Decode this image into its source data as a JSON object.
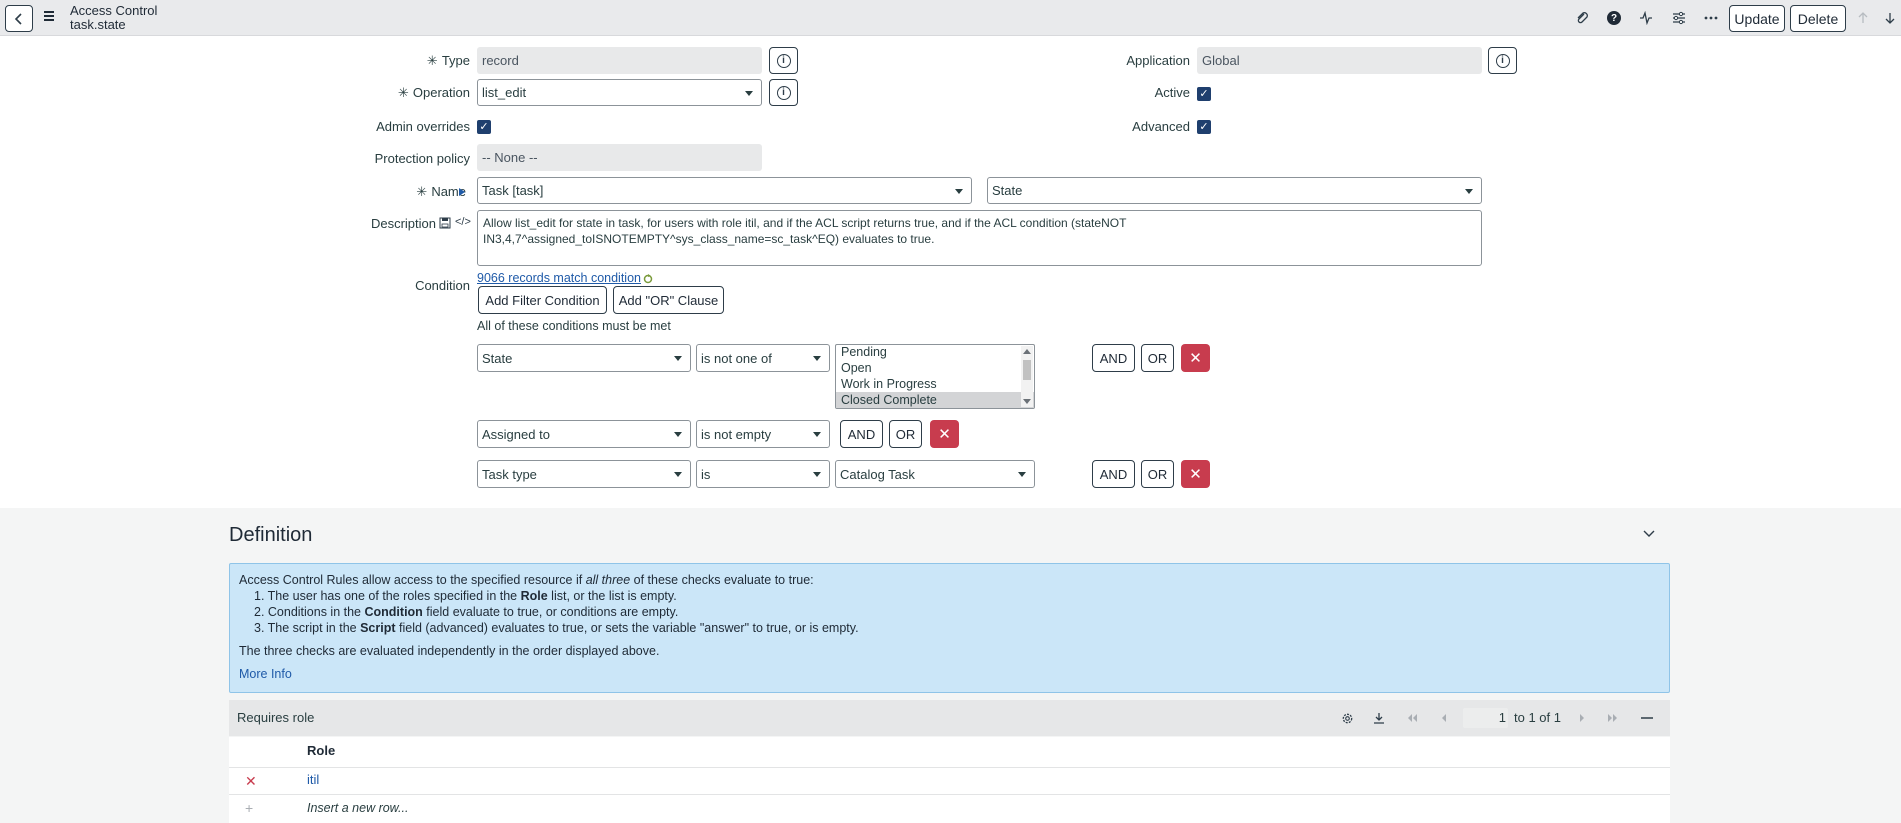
{
  "header": {
    "title_line1": "Access Control",
    "title_line2": "task.state",
    "update_label": "Update",
    "delete_label": "Delete"
  },
  "form": {
    "type": {
      "label": "Type",
      "value": "record"
    },
    "application": {
      "label": "Application",
      "value": "Global"
    },
    "operation": {
      "label": "Operation",
      "value": "list_edit"
    },
    "active": {
      "label": "Active",
      "checked": true
    },
    "admin_overrides": {
      "label": "Admin overrides",
      "checked": true
    },
    "advanced": {
      "label": "Advanced",
      "checked": true
    },
    "protection_policy": {
      "label": "Protection policy",
      "value": "-- None --"
    },
    "name": {
      "label": "Name",
      "table": "Task [task]",
      "field": "State"
    },
    "description": {
      "label": "Description",
      "line1": "Allow list_edit for state in task, for users with role itil, and if the ACL script returns true, and if the ACL condition (stateNOT",
      "line2": "IN3,4,7^assigned_toISNOTEMPTY^sys_class_name=sc_task^EQ) evaluates to true."
    },
    "condition": {
      "label": "Condition",
      "match_link": "9066 records match condition",
      "add_filter_label": "Add Filter Condition",
      "add_or_label": "Add \"OR\" Clause",
      "all_met_text": "All of these conditions must be met",
      "and_label": "AND",
      "or_label": "OR",
      "rows": [
        {
          "field": "State",
          "operator": "is not one of",
          "options": [
            "Pending",
            "Open",
            "Work in Progress",
            "Closed Complete"
          ],
          "selected": "Closed Complete"
        },
        {
          "field": "Assigned to",
          "operator": "is not empty"
        },
        {
          "field": "Task type",
          "operator": "is",
          "value": "Catalog Task"
        }
      ]
    }
  },
  "definition": {
    "title": "Definition",
    "intro_pre": "Access Control Rules allow access to the specified resource if ",
    "intro_em": "all three",
    "intro_post": " of these checks evaluate to true:",
    "item1_pre": "1. The user has one of the roles specified in the ",
    "item1_bold": "Role",
    "item1_post": " list, or the list is empty.",
    "item2_pre": "2. Conditions in the ",
    "item2_bold": "Condition",
    "item2_post": " field evaluate to true, or conditions are empty.",
    "item3_pre": "3. The script in the ",
    "item3_bold": "Script",
    "item3_post": " field (advanced) evaluates to true, or sets the variable \"answer\" to true, or is empty.",
    "footer": "The three checks are evaluated independently in the order displayed above.",
    "more_info": "More Info"
  },
  "related_list": {
    "title": "Requires role",
    "page_value": "1",
    "page_text": "to 1 of 1",
    "column_header": "Role",
    "rows": [
      {
        "role": "itil"
      }
    ],
    "insert_row": "Insert a new row..."
  },
  "colors": {
    "header_bg": "#e9eaec",
    "danger": "#c83c4e",
    "checkbox": "#1f3f6e",
    "info_bg": "#cbe6f8",
    "link": "#1f5aa8"
  }
}
